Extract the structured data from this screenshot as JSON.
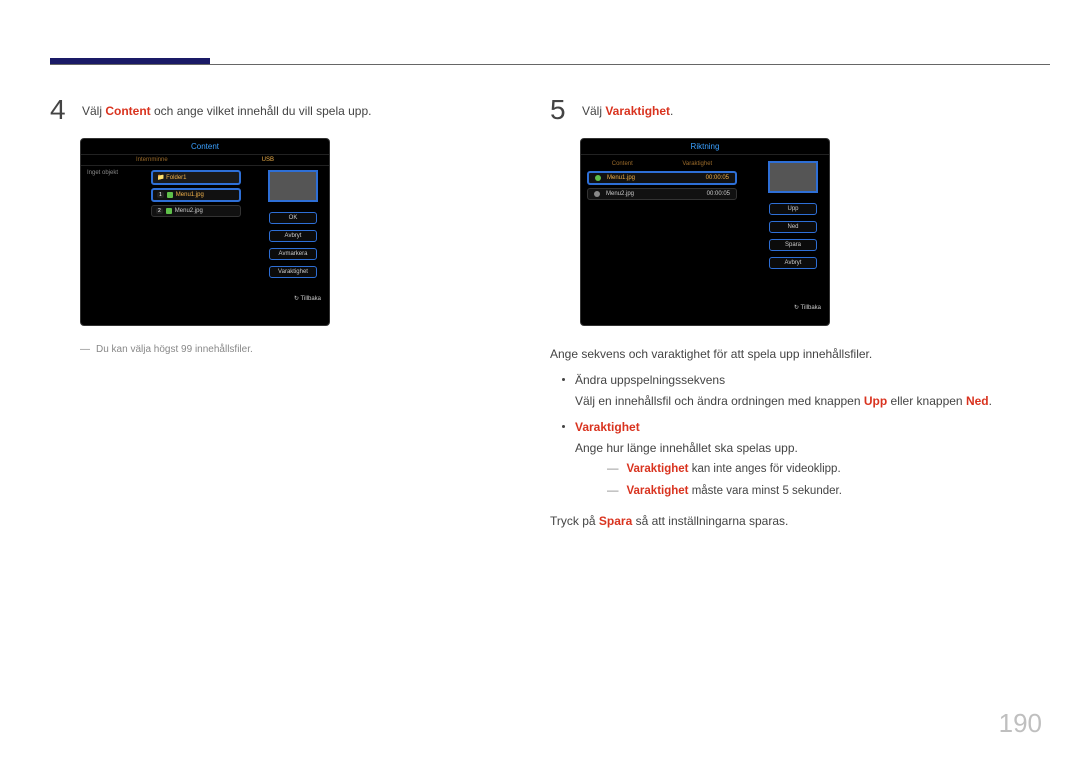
{
  "page_number": "190",
  "left": {
    "step_num": "4",
    "step_pre": "Välj ",
    "step_key": "Content",
    "step_post": " och ange vilket innehåll du vill spela upp.",
    "osd": {
      "title": "Content",
      "tabs": [
        "Internminne",
        "USB"
      ],
      "left_label": "Inget objekt",
      "folder": "Folder1",
      "items": [
        {
          "n": "1",
          "name": "Menu1.jpg"
        },
        {
          "n": "2",
          "name": "Menu2.jpg"
        }
      ],
      "buttons": [
        "OK",
        "Avbryt",
        "Avmarkera",
        "Varaktighet"
      ],
      "back": "Tillbaka"
    },
    "note": "Du kan välja högst 99 innehållsfiler."
  },
  "right": {
    "step_num": "5",
    "step_pre": "Välj ",
    "step_key": "Varaktighet",
    "step_post": ".",
    "osd": {
      "title": "Riktning",
      "cols": [
        "Content",
        "Varaktighet"
      ],
      "rows": [
        {
          "name": "Menu1.jpg",
          "dur": "00:00:05"
        },
        {
          "name": "Menu2.jpg",
          "dur": "00:00:05"
        }
      ],
      "buttons": [
        "Upp",
        "Ned",
        "Spara",
        "Avbryt"
      ],
      "back": "Tillbaka"
    },
    "intro": "Ange sekvens och varaktighet för att spela upp innehållsfiler.",
    "b1_title": "Ändra uppspelningssekvens",
    "b1_pre": "Välj en innehållsfil och ändra ordningen med knappen ",
    "b1_k1": "Upp",
    "b1_mid": " eller knappen ",
    "b1_k2": "Ned",
    "b1_post": ".",
    "b2_title": "Varaktighet",
    "b2_body": "Ange hur länge innehållet ska spelas upp.",
    "b2_s1_k": "Varaktighet",
    "b2_s1_r": " kan inte anges för videoklipp.",
    "b2_s2_k": "Varaktighet",
    "b2_s2_r": " måste vara minst 5 sekunder.",
    "save_pre": "Tryck på ",
    "save_k": "Spara",
    "save_post": " så att inställningarna sparas."
  }
}
